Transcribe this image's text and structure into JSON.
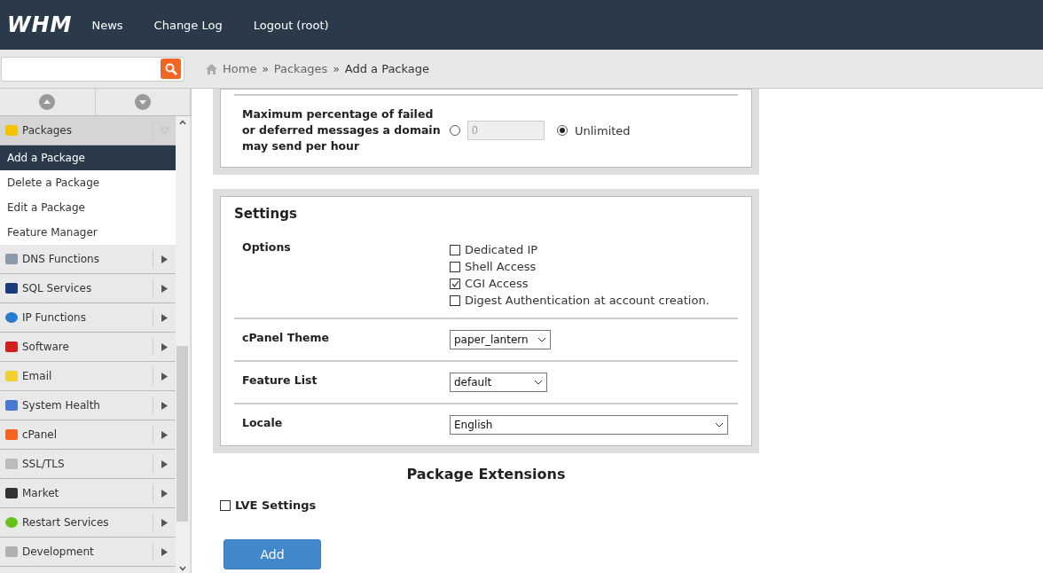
{
  "header": {
    "logo": "WHM",
    "nav": [
      "News",
      "Change Log",
      "Logout (root)"
    ]
  },
  "breadcrumb": [
    {
      "kind": "home",
      "label": "Home"
    },
    {
      "kind": "sep",
      "label": "»"
    },
    {
      "kind": "link",
      "label": "Packages"
    },
    {
      "kind": "sep",
      "label": "»"
    },
    {
      "kind": "current",
      "label": "Add a Package"
    }
  ],
  "sidebar": {
    "categories": [
      {
        "label": "Packages",
        "expanded": true,
        "children": [
          {
            "label": "Add a Package",
            "selected": true
          },
          {
            "label": "Delete a Package",
            "selected": false
          },
          {
            "label": "Edit a Package",
            "selected": false
          },
          {
            "label": "Feature Manager",
            "selected": false
          }
        ]
      },
      {
        "label": "DNS Functions",
        "expanded": false
      },
      {
        "label": "SQL Services",
        "expanded": false
      },
      {
        "label": "IP Functions",
        "expanded": false
      },
      {
        "label": "Software",
        "expanded": false
      },
      {
        "label": "Email",
        "expanded": false
      },
      {
        "label": "System Health",
        "expanded": false
      },
      {
        "label": "cPanel",
        "expanded": false
      },
      {
        "label": "SSL/TLS",
        "expanded": false
      },
      {
        "label": "Market",
        "expanded": false
      },
      {
        "label": "Restart Services",
        "expanded": false
      },
      {
        "label": "Development",
        "expanded": false
      }
    ]
  },
  "limit_panel": {
    "label": "Maximum percentage of failed or deferred messages a domain may send per hour",
    "choices": [
      {
        "kind": "input",
        "value": "0",
        "selected": false
      },
      {
        "kind": "label",
        "label": "Unlimited",
        "selected": true
      }
    ]
  },
  "settings": {
    "title": "Settings",
    "rows": [
      {
        "kind": "checkboxes",
        "label": "Options",
        "options": [
          {
            "label": "Dedicated IP",
            "checked": false
          },
          {
            "label": "Shell Access",
            "checked": false
          },
          {
            "label": "CGI Access",
            "checked": true
          },
          {
            "label": "Digest Authentication at account creation.",
            "checked": false
          }
        ]
      },
      {
        "kind": "select",
        "label": "cPanel Theme",
        "value": "paper_lantern"
      },
      {
        "kind": "select",
        "label": "Feature List",
        "value": "default"
      },
      {
        "kind": "select",
        "label": "Locale",
        "value": "English"
      }
    ]
  },
  "extensions": {
    "title": "Package Extensions",
    "items": [
      {
        "label": "LVE Settings",
        "checked": false
      }
    ]
  },
  "submit": "Add"
}
